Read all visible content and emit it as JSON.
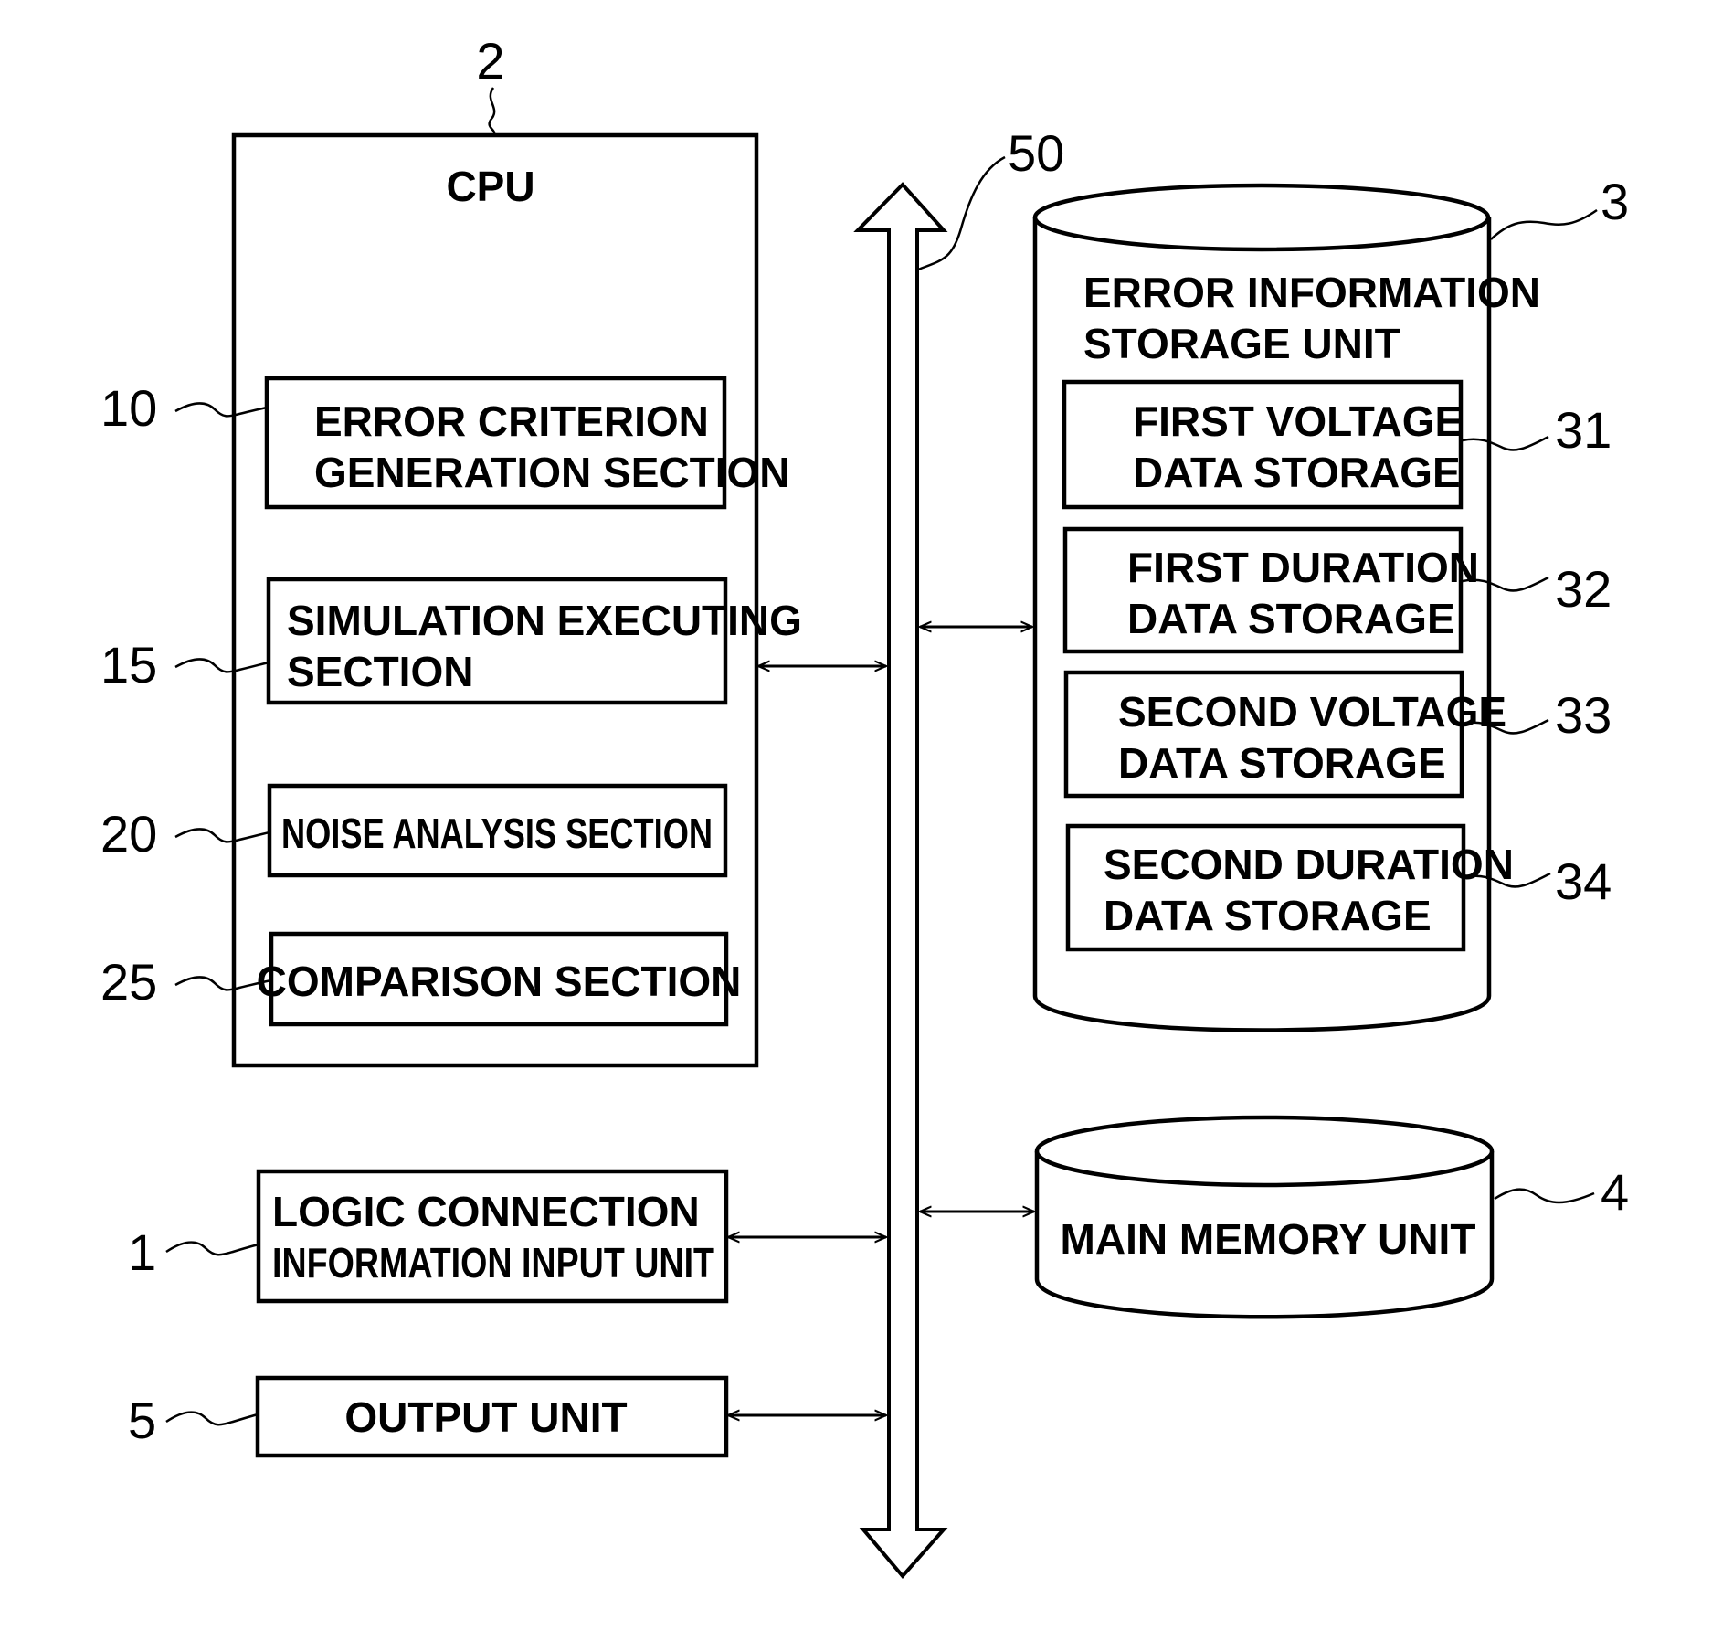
{
  "figure": {
    "cpu": {
      "ref": "2",
      "title": "CPU",
      "sections": [
        {
          "ref": "10",
          "lines": [
            "ERROR CRITERION",
            "GENERATION SECTION"
          ]
        },
        {
          "ref": "15",
          "lines": [
            "SIMULATION EXECUTING",
            "SECTION"
          ]
        },
        {
          "ref": "20",
          "lines": [
            "NOISE ANALYSIS SECTION"
          ]
        },
        {
          "ref": "25",
          "lines": [
            "COMPARISON SECTION"
          ]
        }
      ]
    },
    "input_unit": {
      "ref": "1",
      "lines": [
        "LOGIC CONNECTION",
        "INFORMATION INPUT UNIT"
      ]
    },
    "output_unit": {
      "ref": "5",
      "lines": [
        "OUTPUT UNIT"
      ]
    },
    "bus": {
      "ref": "50"
    },
    "error_storage": {
      "ref": "3",
      "title_lines": [
        "ERROR INFORMATION",
        "STORAGE UNIT"
      ],
      "storages": [
        {
          "ref": "31",
          "lines": [
            "FIRST VOLTAGE",
            "DATA STORAGE"
          ]
        },
        {
          "ref": "32",
          "lines": [
            "FIRST DURATION",
            "DATA STORAGE"
          ]
        },
        {
          "ref": "33",
          "lines": [
            "SECOND VOLTAGE",
            "DATA STORAGE"
          ]
        },
        {
          "ref": "34",
          "lines": [
            "SECOND DURATION",
            "DATA STORAGE"
          ]
        }
      ]
    },
    "main_memory": {
      "ref": "4",
      "lines": [
        "MAIN MEMORY UNIT"
      ]
    }
  }
}
